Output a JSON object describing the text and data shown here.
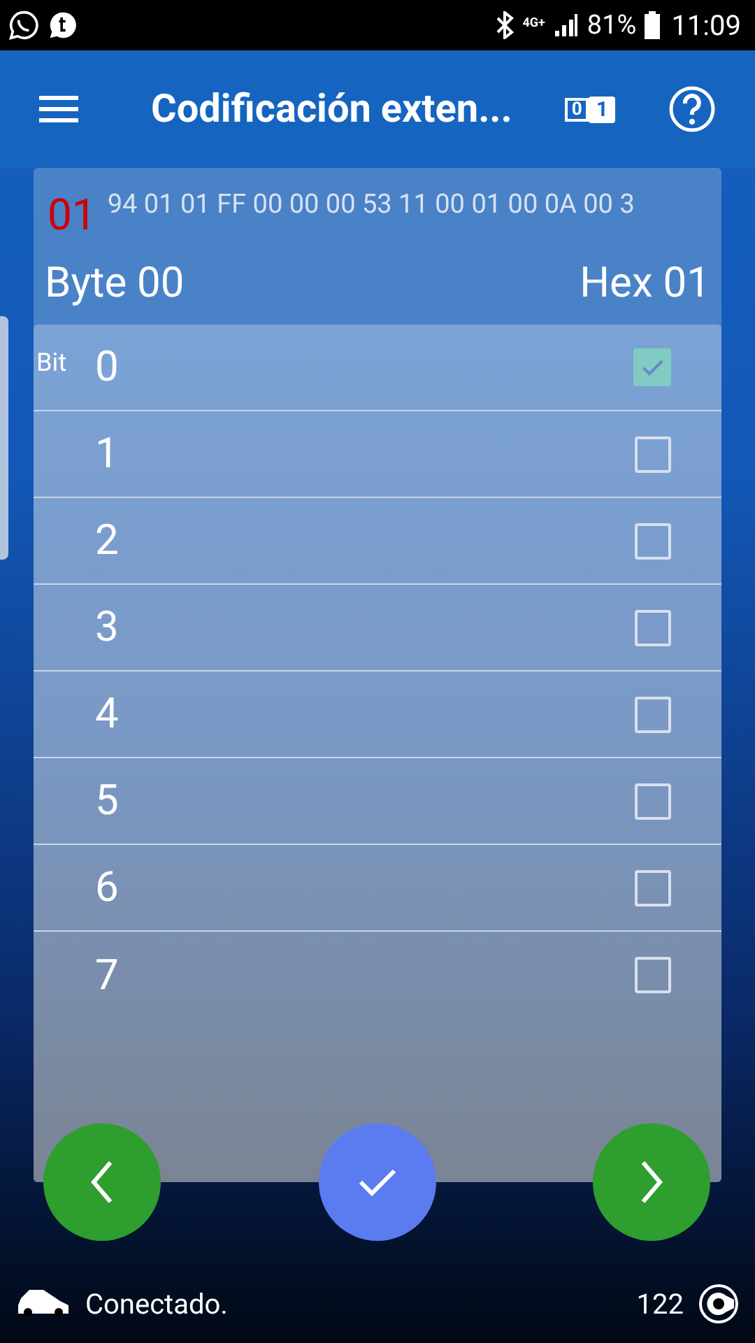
{
  "status_bar": {
    "network": "4G+",
    "battery": "81%",
    "time": "11:09"
  },
  "app_bar": {
    "title": "Codificación exten...",
    "toggle": [
      "0",
      "1"
    ]
  },
  "coding": {
    "index": "01",
    "bytes": "94 01 01 FF 00 00 00 53 11 00 01 00 0A 00 3",
    "byte_label": "Byte 00",
    "hex_label": "Hex 01",
    "bit_label": "Bit"
  },
  "bits": [
    {
      "label": "0",
      "checked": true
    },
    {
      "label": "1",
      "checked": false
    },
    {
      "label": "2",
      "checked": false
    },
    {
      "label": "3",
      "checked": false
    },
    {
      "label": "4",
      "checked": false
    },
    {
      "label": "5",
      "checked": false
    },
    {
      "label": "6",
      "checked": false
    },
    {
      "label": "7",
      "checked": false
    }
  ],
  "footer": {
    "status": "Conectado.",
    "count": "122"
  }
}
